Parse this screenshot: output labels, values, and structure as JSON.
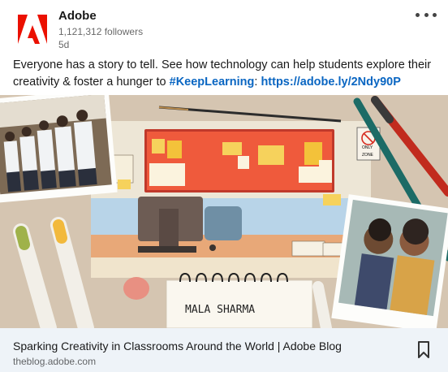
{
  "author": {
    "name": "Adobe",
    "followers": "1,121,312 followers",
    "time": "5d",
    "brand_color": "#eb1000"
  },
  "commentary": {
    "text": "Everyone has a story to tell. See how technology can help students explore their creativity & foster a hunger to ",
    "hashtag": "#KeepLearning",
    "separator": ": ",
    "link": "https://adobe.ly/2Ndy90P"
  },
  "image": {
    "notebook_name": "MALA SHARMA",
    "sign_text": "ONLY",
    "sign_subtext": "ZONE"
  },
  "article": {
    "title": "Sparking Creativity in Classrooms Around the World | Adobe Blog",
    "domain": "theblog.adobe.com"
  },
  "icons": {
    "more": "more-options-icon",
    "bookmark": "bookmark-icon",
    "logo": "adobe-logo"
  }
}
